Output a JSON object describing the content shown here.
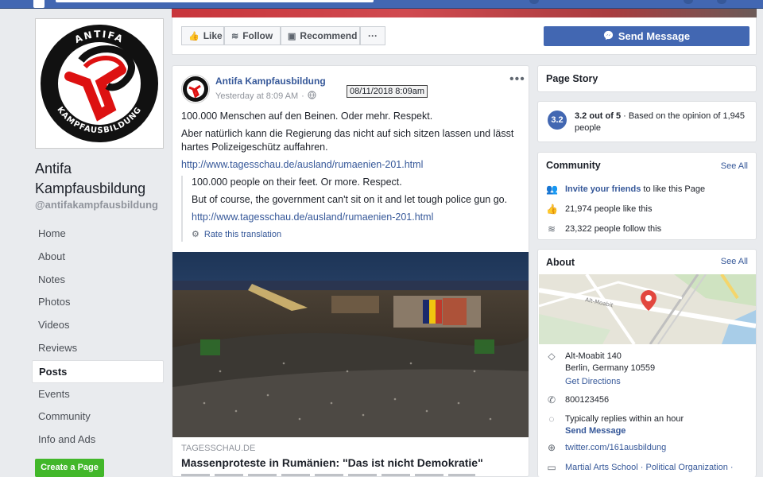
{
  "page": {
    "name": "Antifa Kampfausbildung",
    "handle": "@antifakampfausbildung",
    "logo_top_text": "ANTIFA",
    "logo_bottom_text": "KAMPFAUSBILDUNG"
  },
  "nav": {
    "items": [
      {
        "label": "Home"
      },
      {
        "label": "About"
      },
      {
        "label": "Notes"
      },
      {
        "label": "Photos"
      },
      {
        "label": "Videos"
      },
      {
        "label": "Reviews"
      },
      {
        "label": "Posts"
      },
      {
        "label": "Events"
      },
      {
        "label": "Community"
      },
      {
        "label": "Info and Ads"
      }
    ],
    "active": "Posts",
    "create_page": "Create a Page"
  },
  "actions": {
    "like": "Like",
    "follow": "Follow",
    "recommend": "Recommend",
    "more": "···",
    "send_message": "Send Message"
  },
  "post": {
    "author": "Antifa Kampfausbildung",
    "time": "Yesterday at 8:09 AM",
    "tooltip": "08/11/2018 8:09am",
    "more": "•••",
    "line1": "100.000 Menschen auf den Beinen. Oder mehr. Respekt.",
    "line2": "Aber natürlich kann die Regierung das nicht auf sich sitzen lassen und lässt hartes Polizeigeschütz auffahren.",
    "link": "http://www.tagesschau.de/ausland/rumaenien-201.html",
    "translation": {
      "line1": "100.000 people on their feet. Or more. Respect.",
      "line2": "But of course, the government can't sit on it and let tough police gun go.",
      "link": "http://www.tagesschau.de/ausland/rumaenien-201.html",
      "rate": "Rate this translation"
    },
    "link_domain": "TAGESSCHAU.DE",
    "link_title": "Massenproteste in Rumänien: \"Das ist nicht Demokratie\""
  },
  "sidebar": {
    "page_story": "Page Story",
    "rating": {
      "badge": "3.2",
      "score": "3.2 out of 5",
      "text": " · Based on the opinion of 1,945 people"
    },
    "community": {
      "title": "Community",
      "see_all": "See All",
      "invite_link": "Invite your friends",
      "invite_rest": " to like this Page",
      "likes": "21,974 people like this",
      "follows": "23,322 people follow this"
    },
    "about": {
      "title": "About",
      "see_all": "See All",
      "map_label": "Alt-Moabit",
      "address1": "Alt-Moabit 140",
      "address2": "Berlin, Germany 10559",
      "directions": "Get Directions",
      "phone": "800123456",
      "replies": "Typically replies within an hour",
      "send_message": "Send Message",
      "website": "twitter.com/161ausbildung",
      "categories": "Martial Arts School · Political Organization ·"
    }
  },
  "colors": {
    "brand": "#4267b2",
    "link": "#365899",
    "green": "#42b72a",
    "background": "#e9ebee"
  }
}
